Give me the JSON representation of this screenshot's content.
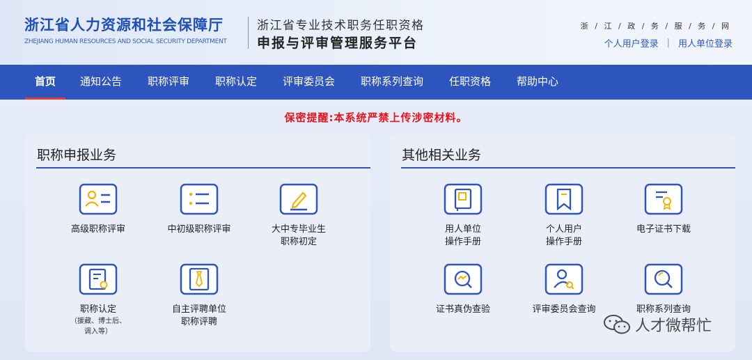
{
  "header": {
    "org_cn": "浙江省人力资源和社会保障厅",
    "org_en": "ZHEJIANG HUMAN RESOURCES AND SOCIAL SECURITY DEPARTMENT",
    "platform_line1": "浙江省专业技术职务任职资格",
    "platform_line2": "申报与评审管理服务平台",
    "portal_name": "浙 / 江 / 政 / 务 / 服 / 务 / 网",
    "personal_login": "个人用户登录",
    "separator": "|",
    "unit_login": "用人单位登录"
  },
  "nav": {
    "items": [
      {
        "label": "首页",
        "active": true
      },
      {
        "label": "通知公告"
      },
      {
        "label": "职称评审"
      },
      {
        "label": "职称认定"
      },
      {
        "label": "评审委员会"
      },
      {
        "label": "职称系列查询"
      },
      {
        "label": "任职资格"
      },
      {
        "label": "帮助中心"
      }
    ]
  },
  "warning": "保密提醒:本系统严禁上传涉密材料。",
  "left_panel": {
    "title": "职称申报业务",
    "tiles": [
      {
        "label": "高级职称评审",
        "icon": "id-card-icon"
      },
      {
        "label": "中初级职称评审",
        "icon": "list-icon"
      },
      {
        "label": "大中专毕业生",
        "label2": "职称初定",
        "icon": "pen-icon"
      },
      {
        "label": "职称认定",
        "sub1": "（援藏、博士后、",
        "sub2": "调入等）",
        "icon": "certificate-doc-icon"
      },
      {
        "label": "自主评聘单位",
        "label2": "职称评聘",
        "icon": "tie-icon"
      }
    ]
  },
  "right_panel": {
    "title": "其他相关业务",
    "tiles": [
      {
        "label": "用人单位",
        "label2": "操作手册",
        "icon": "book-icon"
      },
      {
        "label": "个人用户",
        "label2": "操作手册",
        "icon": "bookmark-icon"
      },
      {
        "label": "电子证书下载",
        "icon": "certificate-award-icon"
      },
      {
        "label": "证书真伪查验",
        "icon": "verify-icon"
      },
      {
        "label": "评审委员会查询",
        "icon": "user-search-icon"
      },
      {
        "label": "职称系列查询",
        "icon": "search-icon"
      }
    ]
  },
  "watermark": {
    "text": "人才微帮忙",
    "icon": "wechat-icon"
  },
  "colors": {
    "primary": "#2e54bd",
    "accent": "#f0b400",
    "warning": "#e8141c"
  }
}
